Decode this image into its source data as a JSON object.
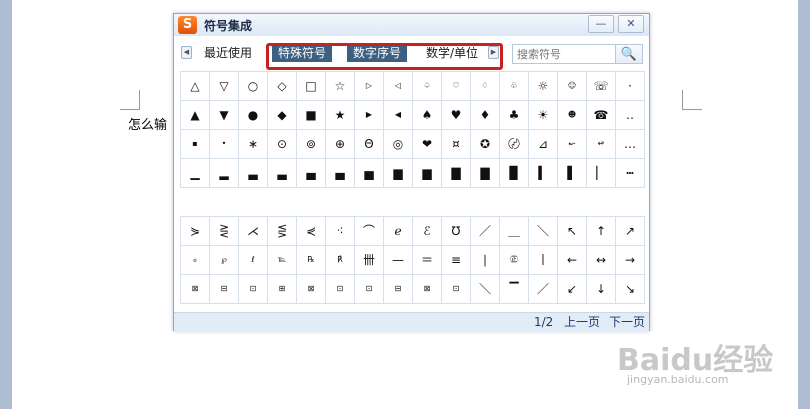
{
  "document": {
    "text": "怎么输"
  },
  "popup": {
    "logo": "S",
    "title": "符号集成",
    "minimize": "—",
    "close": "✕",
    "tabs": {
      "prev_arrow": "◀",
      "recent": "最近使用",
      "special": "特殊符号",
      "digits": "数字序号",
      "math": "数学/单位",
      "next_arrow": "▶"
    },
    "search": {
      "placeholder": "搜索符号",
      "button": "🔍"
    },
    "grid1": [
      [
        "△",
        "▽",
        "○",
        "◇",
        "□",
        "☆",
        "▷",
        "◁",
        "♤",
        "♡",
        "♢",
        "♧",
        "☼",
        "☺",
        "☏",
        "·"
      ],
      [
        "▲",
        "▼",
        "●",
        "◆",
        "■",
        "★",
        "▶",
        "◀",
        "♠",
        "♥",
        "♦",
        "♣",
        "☀",
        "☻",
        "☎",
        "‥"
      ],
      [
        "▪",
        "•",
        "∗",
        "⊙",
        "⊚",
        "⊕",
        "Θ",
        "◎",
        "❤",
        "¤",
        "✪",
        "〄",
        "⊿",
        "↜",
        "↫",
        "…"
      ],
      [
        "▁",
        "▂",
        "▃",
        "▃",
        "▄",
        "▄",
        "▅",
        "▆",
        "▆",
        "▇",
        "▇",
        "▉",
        "▍",
        "▌",
        "▏",
        "┅"
      ]
    ],
    "grid2": [
      [
        "⋟",
        "⋛",
        "⋌",
        "⋚",
        "⋞",
        "⁖",
        "⌒",
        "ℯ",
        "ℰ",
        "℧",
        "／",
        "＿",
        "＼",
        "↖",
        "↑",
        "↗"
      ],
      [
        "ℴ",
        "℘",
        "ℓ",
        "℡",
        "℞",
        "℟",
        "卌",
        "—",
        "＝",
        "≡",
        "∣",
        "㊣",
        "丨",
        "←",
        "↔",
        "→"
      ],
      [
        "⊠",
        "⊟",
        "⊡",
        "⊞",
        "⊠",
        "⊡",
        "⊡",
        "⊟",
        "⊠",
        "⊡",
        "＼",
        "▔",
        "／",
        "↙",
        "↓",
        "↘"
      ]
    ],
    "footer": {
      "page": "1/2",
      "prev": "上一页",
      "next": "下一页"
    }
  },
  "watermark": {
    "logo": "Baidu经验",
    "url": "jingyan.baidu.com"
  }
}
